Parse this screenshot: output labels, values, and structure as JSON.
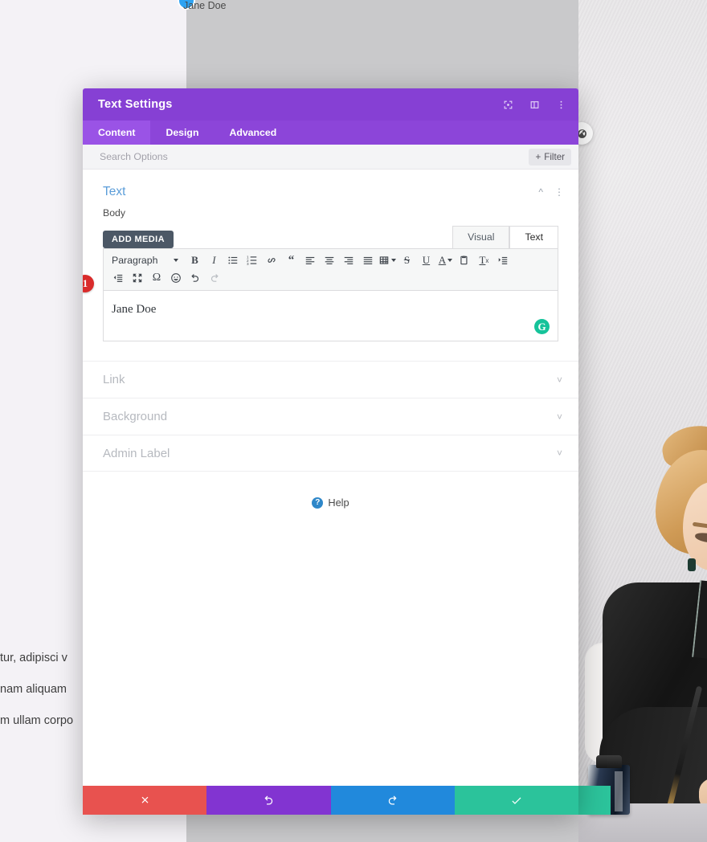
{
  "background": {
    "module_marker_label": "Jane Doe",
    "marker_icon": "module-marker-dot",
    "round_button_icon": "globe-icon",
    "paragraph_lines": [
      "tur, adipisci v",
      "nam aliquam",
      "m ullam corpo"
    ],
    "photo_alt": "woman-writing-photo"
  },
  "modal": {
    "title": "Text Settings",
    "header_icons": [
      {
        "name": "focus-icon",
        "glyph": "focus"
      },
      {
        "name": "layout-toggle-icon",
        "glyph": "layout"
      },
      {
        "name": "more-options-icon",
        "glyph": "dots"
      }
    ],
    "tabs": [
      {
        "label": "Content",
        "active": true
      },
      {
        "label": "Design",
        "active": false
      },
      {
        "label": "Advanced",
        "active": false
      }
    ],
    "search": {
      "placeholder": "Search Options",
      "value": ""
    },
    "filter": {
      "label": "Filter",
      "icon": "plus-icon"
    },
    "section": {
      "title": "Text",
      "collapse_icon": "chevron-up-icon",
      "menu_icon": "vertical-dots-icon"
    },
    "body_field": {
      "label": "Body",
      "add_media_label": "ADD MEDIA",
      "editor_tabs": [
        {
          "label": "Visual",
          "active": false
        },
        {
          "label": "Text",
          "active": true
        }
      ],
      "format_select": "Paragraph",
      "toolbar_row1": [
        {
          "name": "bold-icon",
          "title": "B"
        },
        {
          "name": "italic-icon",
          "title": "I"
        },
        {
          "name": "bulleted-list-icon",
          "title": "ul"
        },
        {
          "name": "numbered-list-icon",
          "title": "ol"
        },
        {
          "name": "link-icon",
          "title": "link"
        },
        {
          "name": "blockquote-icon",
          "title": "quote"
        },
        {
          "name": "align-left-icon",
          "title": "left"
        },
        {
          "name": "align-center-icon",
          "title": "center"
        },
        {
          "name": "align-right-icon",
          "title": "right"
        },
        {
          "name": "align-justify-icon",
          "title": "justify"
        },
        {
          "name": "table-icon",
          "title": "table"
        },
        {
          "name": "strikethrough-icon",
          "title": "S"
        },
        {
          "name": "underline-icon",
          "title": "U"
        },
        {
          "name": "text-color-icon",
          "title": "A"
        },
        {
          "name": "paste-as-text-icon",
          "title": "paste"
        },
        {
          "name": "clear-formatting-icon",
          "title": "Tx"
        },
        {
          "name": "indent-icon",
          "title": "indent"
        }
      ],
      "toolbar_row2": [
        {
          "name": "outdent-icon",
          "title": "outdent"
        },
        {
          "name": "fullscreen-icon",
          "title": "fullscreen"
        },
        {
          "name": "special-character-icon",
          "title": "omega"
        },
        {
          "name": "emoji-icon",
          "title": "smiley"
        },
        {
          "name": "undo-icon",
          "title": "undo"
        },
        {
          "name": "redo-icon",
          "title": "redo",
          "disabled": true
        }
      ],
      "content": "Jane Doe",
      "step_badge": "1",
      "grammar_icon": "grammarly-icon"
    },
    "accordion": [
      {
        "label": "Link",
        "icon": "chevron-down-icon"
      },
      {
        "label": "Background",
        "icon": "chevron-down-icon"
      },
      {
        "label": "Admin Label",
        "icon": "chevron-down-icon"
      }
    ],
    "help": {
      "label": "Help",
      "icon": "question-mark-icon"
    },
    "footer_buttons": [
      {
        "name": "cancel-button",
        "icon": "close-icon",
        "color": "#e8524f"
      },
      {
        "name": "undo-button",
        "icon": "undo-icon",
        "color": "#8234d1"
      },
      {
        "name": "redo-button",
        "icon": "redo-icon",
        "color": "#2189dc"
      },
      {
        "name": "save-button",
        "icon": "check-icon",
        "color": "#2bc39b"
      }
    ]
  }
}
